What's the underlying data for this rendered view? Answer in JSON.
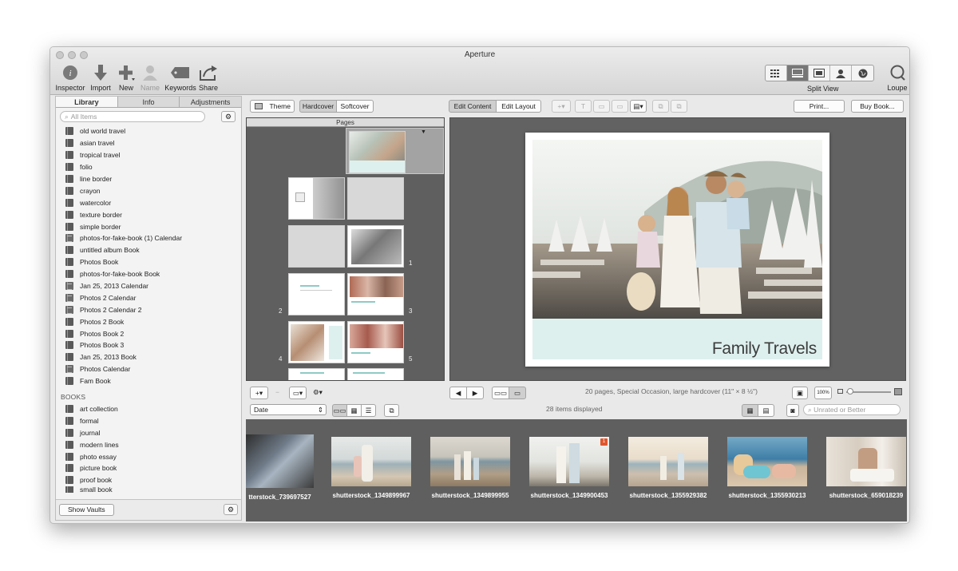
{
  "window": {
    "title": "Aperture"
  },
  "toolbar": {
    "inspector": "Inspector",
    "import": "Import",
    "new": "New",
    "name": "Name",
    "keywords": "Keywords",
    "share": "Share",
    "split_view": "Split View",
    "loupe": "Loupe"
  },
  "sidebar": {
    "tabs": [
      "Library",
      "Info",
      "Adjustments"
    ],
    "search_placeholder": "All Items",
    "items": [
      "old world travel",
      "asian travel",
      "tropical travel",
      "folio",
      "line border",
      "crayon",
      "watercolor",
      "texture border",
      "simple border",
      "photos-for-fake-book (1) Calendar",
      "untitled album Book",
      "Photos Book",
      "photos-for-fake-book Book",
      "Jan 25, 2013 Calendar",
      "Photos 2 Calendar",
      "Photos 2 Calendar 2",
      "Photos 2 Book",
      "Photos Book 2",
      "Photos Book 3",
      "Jan 25, 2013 Book",
      "Photos Calendar",
      "Fam Book"
    ],
    "books_header": "BOOKS",
    "books": [
      "art collection",
      "formal",
      "journal",
      "modern lines",
      "photo essay",
      "picture book",
      "proof book",
      "small book"
    ],
    "show_vaults": "Show Vaults"
  },
  "booktoolbar": {
    "theme": "Theme",
    "hardcover": "Hardcover",
    "softcover": "Softcover",
    "edit_content": "Edit Content",
    "edit_layout": "Edit Layout",
    "print": "Print...",
    "buy_book": "Buy Book..."
  },
  "pages": {
    "header": "Pages",
    "numbers": [
      "1",
      "2",
      "3",
      "4",
      "5"
    ]
  },
  "cover": {
    "title": "Family Travels"
  },
  "preview_info": "20 pages, Special Occasion, large hardcover (11\" × 8 ½\")",
  "zoom_label": "100%",
  "browser": {
    "sort": "Date",
    "count": "28 items displayed",
    "filter": "Unrated or Better"
  },
  "thumbnails": [
    "tterstock_739697527",
    "shutterstock_1349899967",
    "shutterstock_1349899955",
    "shutterstock_1349900453",
    "shutterstock_1355929382",
    "shutterstock_1355930213",
    "shutterstock_659018239"
  ],
  "badge": "1",
  "colors": {
    "accent_band": "#def0ee",
    "panel_dark": "#5f5f5f"
  }
}
